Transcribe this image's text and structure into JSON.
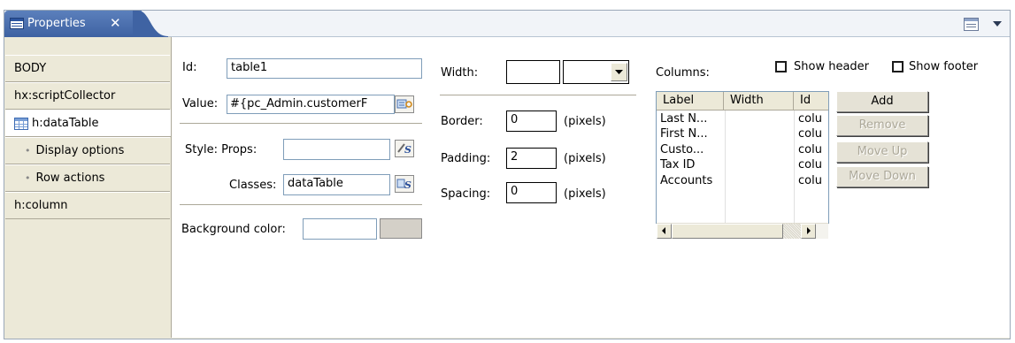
{
  "view": {
    "tab_title": "Properties",
    "tab_close": "✕",
    "icons": [
      "properties-icon",
      "close-icon",
      "view-menu-icon",
      "chevron-down-icon"
    ]
  },
  "nav": {
    "items": [
      {
        "label": "BODY"
      },
      {
        "label": "hx:scriptCollector"
      },
      {
        "label": "h:dataTable",
        "selected": true,
        "icon": "table-icon"
      },
      {
        "label": "Display options",
        "sub": true
      },
      {
        "label": "Row actions",
        "sub": true
      },
      {
        "label": "h:column"
      }
    ],
    "bullet": "•"
  },
  "form": {
    "id_label": "Id:",
    "id_value": "table1",
    "value_label": "Value:",
    "value_value": "#{pc_Admin.customerF",
    "style_label": "Style: Props:",
    "style_value": "",
    "classes_label": "Classes:",
    "classes_value": "dataTable",
    "bg_label": "Background color:",
    "bg_value": ""
  },
  "layout_props": {
    "width_label": "Width:",
    "width_value": "",
    "width_unit": "",
    "border_label": "Border:",
    "border_value": "0",
    "padding_label": "Padding:",
    "padding_value": "2",
    "spacing_label": "Spacing:",
    "spacing_value": "0",
    "unit": "(pixels)"
  },
  "columns": {
    "label": "Columns:",
    "show_header": "Show header",
    "show_footer": "Show footer",
    "headers": [
      "Label",
      "Width",
      "Id"
    ],
    "rows": [
      [
        "Last N...",
        "",
        "colu"
      ],
      [
        "First N...",
        "",
        "colu"
      ],
      [
        "Custo...",
        "",
        "colu"
      ],
      [
        "Tax ID",
        "",
        "colu"
      ],
      [
        "Accounts",
        "",
        "colu"
      ]
    ],
    "buttons": {
      "add": "Add",
      "remove": "Remove",
      "move_up": "Move Up",
      "move_down": "Move Down"
    }
  },
  "colors": {
    "tab_bg": "#4a6fae",
    "panel_bg": "#ece9d8",
    "field_border": "#7f9db9"
  }
}
